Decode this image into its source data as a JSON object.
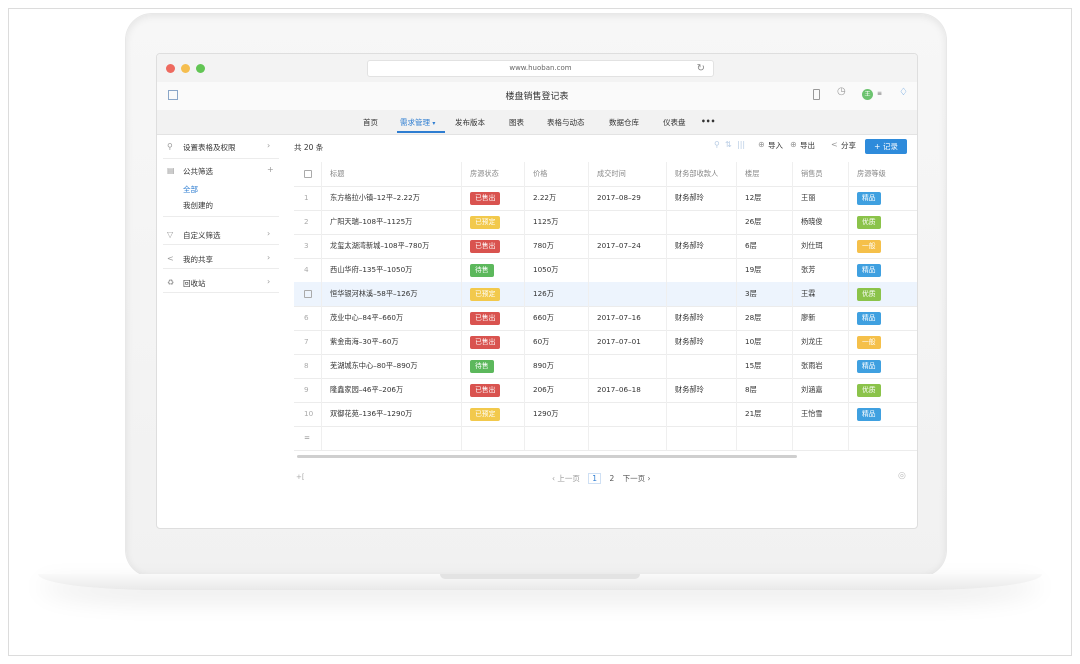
{
  "browser": {
    "url": "www.huoban.com"
  },
  "app": {
    "title": "楼盘销售登记表",
    "user_initials": "王"
  },
  "tabs": [
    {
      "label": "首页"
    },
    {
      "label": "需求管理"
    },
    {
      "label": "发布版本"
    },
    {
      "label": "图表"
    },
    {
      "label": "表格与动态"
    },
    {
      "label": "数据仓库"
    },
    {
      "label": "仪表盘"
    },
    {
      "label": "•••"
    }
  ],
  "sidebar": {
    "settings": "设置表格及权限",
    "public_filter": "公共筛选",
    "all": "全部",
    "mine": "我创建的",
    "custom_filter": "自定义筛选",
    "my_share": "我的共享",
    "recycle": "回收站"
  },
  "toolbar": {
    "count": "共 20 条",
    "import": "导入",
    "export": "导出",
    "share": "分享",
    "add_record": "+ 记录"
  },
  "table": {
    "headers": [
      "标题",
      "房源状态",
      "价格",
      "成交时间",
      "财务部收款人",
      "楼层",
      "销售员",
      "房源等级"
    ],
    "rows": [
      {
        "num": "1",
        "title": "东方格拉小镇–12平–2.22万",
        "status": "已售出",
        "price": "2.22万",
        "date": "2017–08–29",
        "payee": "财务郝玲",
        "floor": "12层",
        "seller": "王丽",
        "level": "精品"
      },
      {
        "num": "2",
        "title": "广阳天瑞–108平–1125万",
        "status": "已预定",
        "price": "1125万",
        "date": "",
        "payee": "",
        "floor": "26层",
        "seller": "杨晓俊",
        "level": "优质"
      },
      {
        "num": "3",
        "title": "龙玺太湖湾新城–108平–780万",
        "status": "已售出",
        "price": "780万",
        "date": "2017–07–24",
        "payee": "财务郝玲",
        "floor": "6层",
        "seller": "刘仕珥",
        "level": "一般"
      },
      {
        "num": "4",
        "title": "西山华府–135平–1050万",
        "status": "待售",
        "price": "1050万",
        "date": "",
        "payee": "",
        "floor": "19层",
        "seller": "张芳",
        "level": "精品"
      },
      {
        "num": "",
        "title": "恒华银河林溪–58平–126万",
        "status": "已预定",
        "price": "126万",
        "date": "",
        "payee": "",
        "floor": "3层",
        "seller": "王霖",
        "level": "优质"
      },
      {
        "num": "6",
        "title": "茂业中心–84平–660万",
        "status": "已售出",
        "price": "660万",
        "date": "2017–07–16",
        "payee": "财务郝玲",
        "floor": "28层",
        "seller": "廖新",
        "level": "精品"
      },
      {
        "num": "7",
        "title": "紫金南海–30平–60万",
        "status": "已售出",
        "price": "60万",
        "date": "2017–07–01",
        "payee": "财务郝玲",
        "floor": "10层",
        "seller": "刘龙庄",
        "level": "一般"
      },
      {
        "num": "8",
        "title": "芜湖城东中心–80平–890万",
        "status": "待售",
        "price": "890万",
        "date": "",
        "payee": "",
        "floor": "15层",
        "seller": "张雨岩",
        "level": "精品"
      },
      {
        "num": "9",
        "title": "隆鑫家园–46平–206万",
        "status": "已售出",
        "price": "206万",
        "date": "2017–06–18",
        "payee": "财务郝玲",
        "floor": "8层",
        "seller": "刘涵嘉",
        "level": "优质"
      },
      {
        "num": "10",
        "title": "双御花苑–136平–1290万",
        "status": "已预定",
        "price": "1290万",
        "date": "",
        "payee": "",
        "floor": "21层",
        "seller": "王怡雪",
        "level": "精品"
      }
    ],
    "footer_symbol": "="
  },
  "pager": {
    "prev": "‹ 上一页",
    "page1": "1",
    "page2": "2",
    "next": "下一页 ›"
  },
  "colors": {
    "sold": "#d9534f",
    "reserved": "#f2c94c",
    "available": "#5cb85c",
    "level_fine": "#3fa0e0",
    "level_good": "#8bc34a",
    "level_normal": "#f5c04a",
    "accent": "#2e7dd1"
  }
}
